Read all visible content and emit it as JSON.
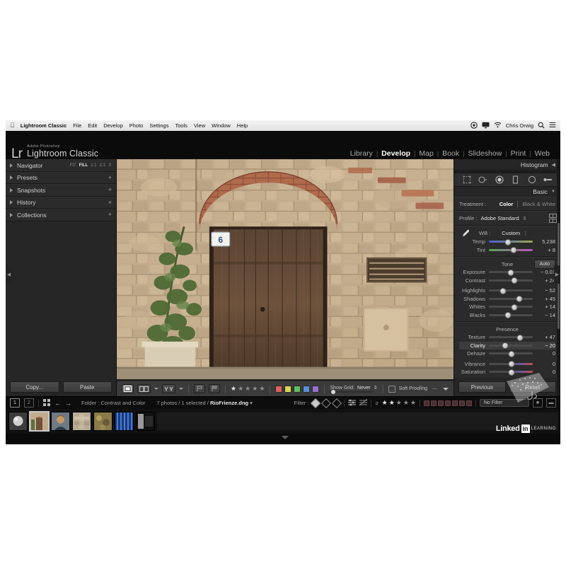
{
  "macbar": {
    "apple_icon": "apple-icon",
    "app_name": "Lightroom Classic",
    "menus": [
      "File",
      "Edit",
      "Develop",
      "Photo",
      "Settings",
      "Tools",
      "View",
      "Window",
      "Help"
    ],
    "user": "Chris Orwig",
    "right_icons": [
      "timemachine-icon",
      "display-icon",
      "wifi-icon",
      "search-icon",
      "controlcenter-icon"
    ]
  },
  "titlebar": {
    "logo": "Lr",
    "brand_small": "Adobe Photoshop",
    "brand": "Lightroom Classic",
    "modules": [
      {
        "label": "Library",
        "active": false
      },
      {
        "label": "Develop",
        "active": true
      },
      {
        "label": "Map",
        "active": false
      },
      {
        "label": "Book",
        "active": false
      },
      {
        "label": "Slideshow",
        "active": false
      },
      {
        "label": "Print",
        "active": false
      },
      {
        "label": "Web",
        "active": false
      }
    ]
  },
  "left_panel": {
    "navigator": {
      "label": "Navigator",
      "zoom_levels": [
        {
          "label": "FIT",
          "active": false
        },
        {
          "label": "FILL",
          "active": true
        },
        {
          "label": "1:1",
          "active": false
        },
        {
          "label": "2:1",
          "active": false
        }
      ]
    },
    "sections": [
      {
        "label": "Presets",
        "control": "plus-icon"
      },
      {
        "label": "Snapshots",
        "control": "plus-icon"
      },
      {
        "label": "History",
        "control": "close-icon"
      },
      {
        "label": "Collections",
        "control": "plus-icon"
      }
    ],
    "copy_label": "Copy...",
    "paste_label": "Paste"
  },
  "toolbar": {
    "view_loupe": "E",
    "view_compare": "BB",
    "view_survey": "YY",
    "flag_pick": "flag-icon",
    "flag_reject": "flag-reject-icon",
    "rating": 1,
    "rating_max": 5,
    "color_labels": [
      "#e0605e",
      "#d8d84e",
      "#5fbf5f",
      "#5a8fd8",
      "#9b6fd0"
    ],
    "show_grid_label": "Show Grid:",
    "show_grid_value": "Never",
    "soft_proofing_label": "Soft Proofing",
    "soft_proofing_checked": false
  },
  "right_panel": {
    "histogram_label": "Histogram",
    "tools": [
      "crop-icon",
      "spot-removal-icon",
      "red-eye-icon",
      "graduated-filter-icon",
      "radial-filter-icon",
      "adjustment-brush-icon"
    ],
    "basic_label": "Basic",
    "treatment": {
      "label": "Treatment :",
      "options": [
        {
          "label": "Color",
          "active": true
        },
        {
          "label": "Black & White",
          "active": false
        }
      ]
    },
    "profile": {
      "label": "Profile :",
      "value": "Adobe Standard",
      "browser_icon": "profile-browser-icon"
    },
    "white_balance": {
      "eyedropper_icon": "eyedropper-icon",
      "label": "WB :",
      "value": "Custom",
      "sliders": [
        {
          "name": "Temp",
          "value": "5,238",
          "pos": 42,
          "type": "temp"
        },
        {
          "name": "Tint",
          "value": "+ 8",
          "pos": 55,
          "type": "tint"
        }
      ]
    },
    "tone": {
      "title": "Tone",
      "auto_label": "Auto",
      "group_a": [
        {
          "name": "Exposure",
          "value": "− 0.01",
          "pos": 49
        },
        {
          "name": "Contrast",
          "value": "+ 24",
          "pos": 57
        }
      ],
      "group_b": [
        {
          "name": "Highlights",
          "value": "− 52",
          "pos": 30
        },
        {
          "name": "Shadows",
          "value": "+ 45",
          "pos": 68
        },
        {
          "name": "Whites",
          "value": "+ 14",
          "pos": 56
        },
        {
          "name": "Blacks",
          "value": "− 14",
          "pos": 42
        }
      ]
    },
    "presence": {
      "title": "Presence",
      "group_a": [
        {
          "name": "Texture",
          "value": "+ 47",
          "pos": 70,
          "active": false
        },
        {
          "name": "Clarity",
          "value": "− 20",
          "pos": 36,
          "active": true
        },
        {
          "name": "Dehaze",
          "value": "0",
          "pos": 50,
          "active": false
        }
      ],
      "group_b": [
        {
          "name": "Vibrance",
          "value": "0",
          "pos": 50,
          "type": "vib",
          "active": false
        },
        {
          "name": "Saturation",
          "value": "0",
          "pos": 50,
          "type": "vib",
          "active": false
        }
      ]
    },
    "previous_label": "Previous",
    "reset_label": "Reset"
  },
  "statusbar": {
    "screen_1": "1",
    "screen_2": "2",
    "grid_icon": "grid-icon",
    "back_icon": "arrow-left-icon",
    "forward_icon": "arrow-right-icon",
    "folder_text": "Folder : Contrast and Color",
    "selection_prefix": "7 photos / 1 selected / ",
    "selection_file": "RioFrienze.dng",
    "filter_label": "Filter :",
    "filter_value": "No Filter",
    "filter_rating_op": "≥",
    "filter_rating": 2,
    "filter_rating_max": 5
  },
  "filmstrip": {
    "thumbnails": [
      {
        "name": "thumb-sphere",
        "selected": false
      },
      {
        "name": "thumb-door",
        "selected": true
      },
      {
        "name": "thumb-portrait",
        "selected": false
      },
      {
        "name": "thumb-wall",
        "selected": false
      },
      {
        "name": "thumb-texture",
        "selected": false
      },
      {
        "name": "thumb-blue-stripes",
        "selected": false
      },
      {
        "name": "thumb-dark",
        "selected": false
      }
    ]
  },
  "branding": {
    "linked": "Linked",
    "in": "in",
    "learning": "LEARNING"
  },
  "watermark": {
    "text": "رباکس ابزار"
  },
  "colors": {
    "panel_bg": "#262626",
    "window_bg": "#1c1c1c",
    "accent": "#ffffff",
    "text_dim": "#a2a2a2"
  }
}
